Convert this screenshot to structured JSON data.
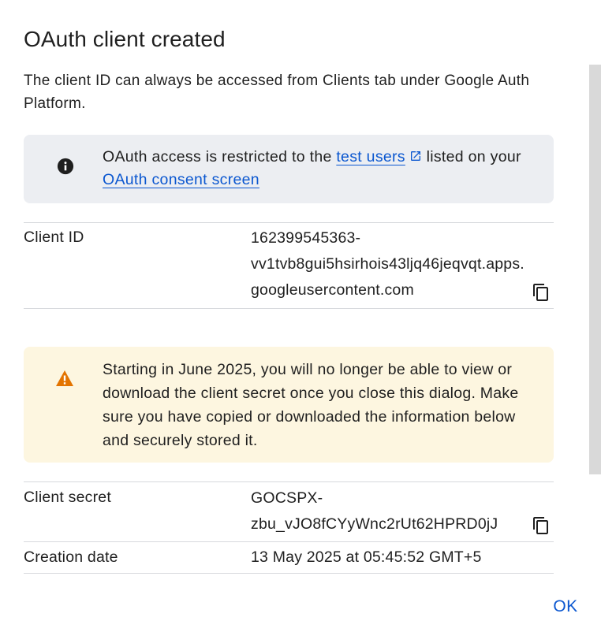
{
  "dialog": {
    "title": "OAuth client created",
    "description": "The client ID can always be accessed from Clients tab under Google Auth Platform."
  },
  "info_banner": {
    "icon": "info-icon",
    "text_before": "OAuth access is restricted to the ",
    "link1": "test users",
    "text_middle": " listed on your ",
    "link2": "OAuth consent screen"
  },
  "client_id": {
    "label": "Client ID",
    "line1": "162399545363-",
    "line2": "vv1tvb8gui5hsirhois43ljq46jeqvqt.apps.",
    "line3": "googleusercontent.com",
    "copy_icon": "copy-icon"
  },
  "warning_banner": {
    "icon": "warning-icon",
    "text": "Starting in June 2025, you will no longer be able to view or download the client secret once you close this dialog. Make sure you have copied or downloaded the information below and securely stored it."
  },
  "client_secret": {
    "label": "Client secret",
    "line1": "GOCSPX-",
    "line2": "zbu_vJO8fCYyWnc2rUt62HPRD0jJ",
    "copy_icon": "copy-icon"
  },
  "creation_date": {
    "label": "Creation date",
    "value": "13 May 2025 at 05:45:52 GMT+5"
  },
  "actions": {
    "ok_label": "OK"
  },
  "colors": {
    "link": "#0b57d0",
    "info_bg": "#eceef2",
    "warning_bg": "#fdf6e0",
    "warning_icon": "#e37400"
  }
}
